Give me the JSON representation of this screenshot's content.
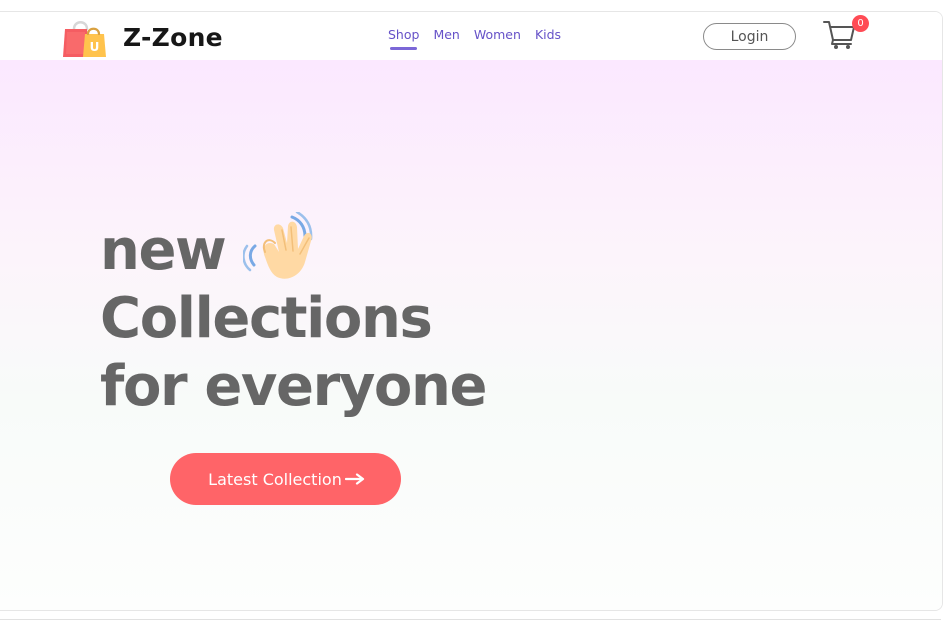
{
  "header": {
    "brand_name": "Z-Zone",
    "logo_icon": "shopping-bag-icon",
    "logo_badge_letter": "U",
    "nav": [
      {
        "label": "Shop",
        "active": true
      },
      {
        "label": "Men",
        "active": false
      },
      {
        "label": "Women",
        "active": false
      },
      {
        "label": "Kids",
        "active": false
      }
    ],
    "login_label": "Login",
    "cart_icon": "shopping-cart-icon",
    "cart_count": "0"
  },
  "hero": {
    "heading_lines": [
      "new",
      "Collections",
      "for everyone"
    ],
    "heading_icon": "waving-hand-icon",
    "cta_label": "Latest Collection",
    "cta_icon": "right-arrow-icon"
  },
  "colors": {
    "nav_text": "#6652c8",
    "active_underline": "#7b67d7",
    "cta": "#ff6468",
    "cart_badge": "#ff4b55",
    "heading": "#666666",
    "hero_gradient_top": "#fbe8ff",
    "hero_gradient_bottom": "#fdfefd"
  }
}
